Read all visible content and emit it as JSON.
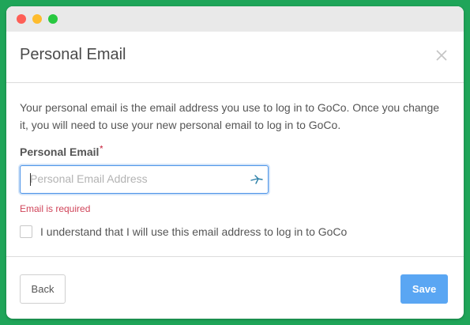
{
  "window": {
    "controls": [
      "close",
      "minimize",
      "maximize"
    ]
  },
  "modal": {
    "title": "Personal Email",
    "close_icon": "close-icon",
    "description": "Your personal email is the email address you use to log in to GoCo. Once you change it, you will need to use your new personal email to log in to GoCo.",
    "field": {
      "label": "Personal Email",
      "required_marker": "*",
      "placeholder": "Personal Email Address",
      "value": "",
      "autofill_icon": "autofill-key-icon",
      "error": "Email is required"
    },
    "confirm_checkbox": {
      "checked": false,
      "label": "I understand that I will use this email address to log in to GoCo"
    },
    "footer": {
      "back_label": "Back",
      "save_label": "Save"
    }
  },
  "colors": {
    "background": "#1fa559",
    "accent": "#5aa6f3",
    "focus": "#4b93e8",
    "error": "#d0455a"
  }
}
